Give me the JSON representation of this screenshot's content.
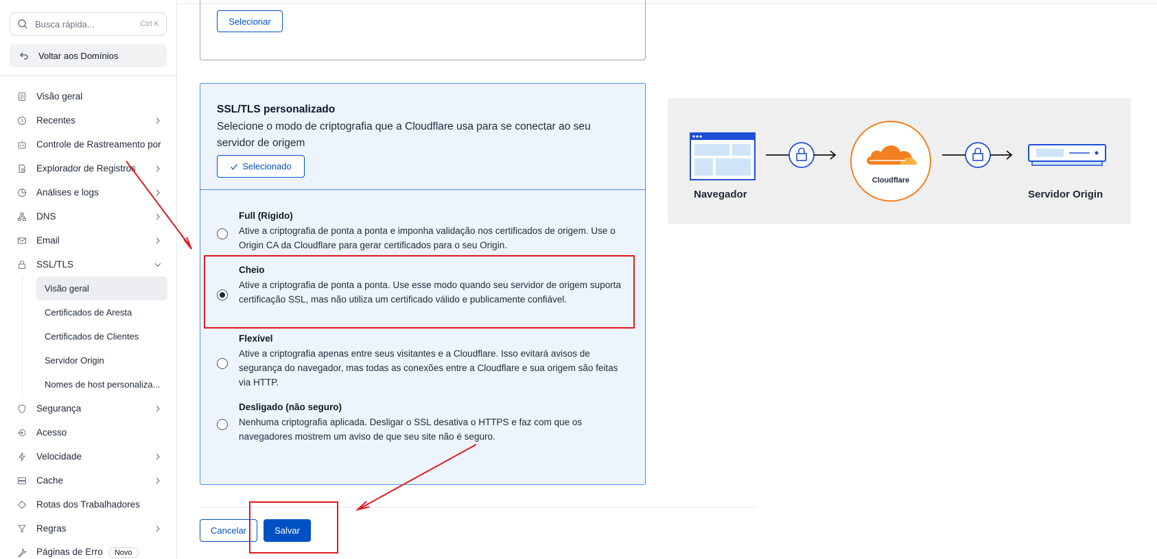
{
  "search": {
    "placeholder": "Busca rápida...",
    "shortcut": "Ctrl K"
  },
  "back_label": "Voltar aos Domínios",
  "nav": {
    "items": [
      {
        "label": "Visão geral",
        "icon": "document-icon"
      },
      {
        "label": "Recentes",
        "icon": "history-icon"
      },
      {
        "label": "Controle de Rastreamento por I.",
        "icon": "crawler-icon"
      },
      {
        "label": "Explorador de Registros",
        "icon": "registry-icon"
      },
      {
        "label": "Análises e logs",
        "icon": "chart-icon"
      },
      {
        "label": "DNS",
        "icon": "network-icon"
      },
      {
        "label": "Email",
        "icon": "mail-icon"
      },
      {
        "label": "SSL/TLS",
        "icon": "lock-icon"
      }
    ],
    "ssl_sub": [
      "Visão geral",
      "Certificados de Aresta",
      "Certificados de Clientes",
      "Servidor Origin",
      "Nomes de host personaliza..."
    ],
    "items2": [
      {
        "label": "Segurança",
        "icon": "shield-icon"
      },
      {
        "label": "Acesso",
        "icon": "access-icon"
      },
      {
        "label": "Velocidade",
        "icon": "bolt-icon"
      },
      {
        "label": "Cache",
        "icon": "cache-icon"
      },
      {
        "label": "Rotas dos Trabalhadores",
        "icon": "route-icon"
      },
      {
        "label": "Regras",
        "icon": "rules-icon"
      },
      {
        "label": "Páginas de Erro",
        "icon": "wrench-icon",
        "badge": "Novo"
      }
    ]
  },
  "top_card": {
    "button": "Selecionar"
  },
  "panel": {
    "title": "SSL/TLS personalizado",
    "description": "Selecione o modo de criptografia que a Cloudflare usa para se conectar ao seu servidor de origem",
    "selected_button": "Selecionado",
    "options": [
      {
        "title": "Full (Rígido)",
        "desc": "Ative a criptografia de ponta a ponta e imponha validação nos certificados de origem. Use o Origin CA da Cloudflare para gerar certificados para o seu Origin.",
        "checked": false
      },
      {
        "title": "Cheio",
        "desc": "Ative a criptografia de ponta a ponta. Use esse modo quando seu servidor de origem suporta certificação SSL, mas não utiliza um certificado válido e publicamente confiável.",
        "checked": true
      },
      {
        "title": "Flexível",
        "desc": "Ative a criptografia apenas entre seus visitantes e a Cloudflare. Isso evitará avisos de segurança do navegador, mas todas as conexões entre a Cloudflare e sua origem são feitas via HTTP.",
        "checked": false
      },
      {
        "title": "Desligado (não seguro)",
        "desc": "Nenhuma criptografia aplicada. Desligar o SSL desativa o HTTPS e faz com que os navegadores mostrem um aviso de que seu site não é seguro.",
        "checked": false
      }
    ]
  },
  "actions": {
    "cancel": "Cancelar",
    "save": "Salvar"
  },
  "diagram": {
    "browser": "Navegador",
    "cloudflare": "Cloudflare",
    "origin": "Servidor Origin"
  },
  "colors": {
    "accent": "#0051c3",
    "cloudflare_orange": "#f38020",
    "annotation_red": "#e0191b"
  }
}
